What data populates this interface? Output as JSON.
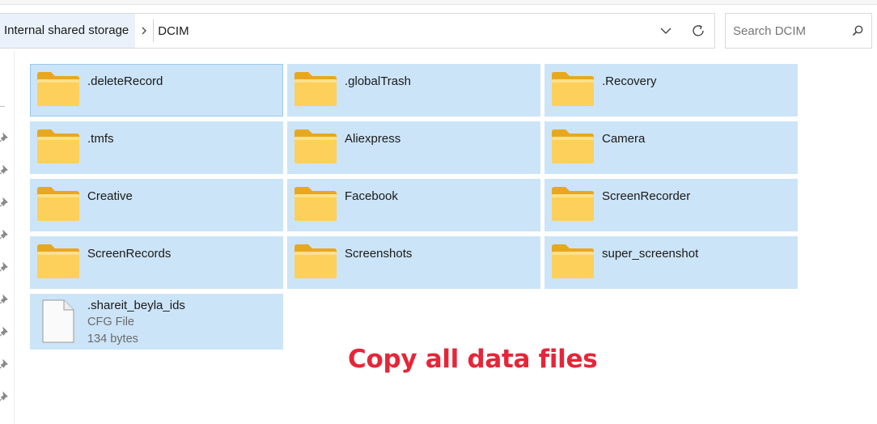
{
  "breadcrumb": {
    "root": "Internal shared storage",
    "current": "DCIM"
  },
  "search": {
    "placeholder": "Search DCIM"
  },
  "icons": {
    "chevron_separator": "chevron-right-icon",
    "dropdown": "chevron-down-icon",
    "refresh": "refresh-icon",
    "search": "search-icon",
    "folder": "folder-icon",
    "file": "file-icon",
    "pin": "pin-icon"
  },
  "colors": {
    "selection": "#cce4f7",
    "selection_border": "#99c9ef",
    "folder": "#f8c844",
    "overlay_text": "#e52638"
  },
  "items": [
    {
      "name": ".deleteRecord"
    },
    {
      "name": ".globalTrash"
    },
    {
      "name": ".Recovery"
    },
    {
      "name": ".tmfs"
    },
    {
      "name": "Aliexpress"
    },
    {
      "name": "Camera"
    },
    {
      "name": "Creative"
    },
    {
      "name": "Facebook"
    },
    {
      "name": "ScreenRecorder"
    },
    {
      "name": "ScreenRecords"
    },
    {
      "name": "Screenshots"
    },
    {
      "name": "super_screenshot"
    }
  ],
  "file": {
    "name": ".shareit_beyla_ids",
    "type": "CFG File",
    "size": "134 bytes"
  },
  "overlay": {
    "caption": "Copy all data files"
  }
}
